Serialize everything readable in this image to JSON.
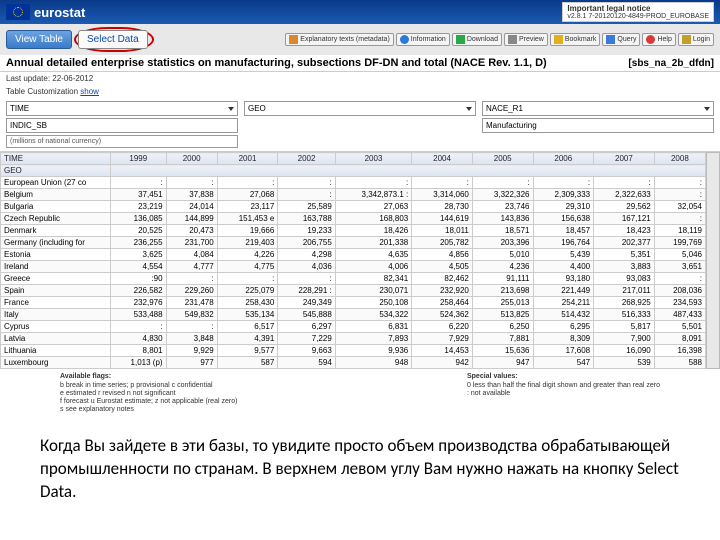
{
  "header": {
    "brand": "eurostat",
    "legal_title": "Important legal notice",
    "legal_sub": "v2.8.1 7-20120120-4849-PROD_EUROBASE"
  },
  "tabs": {
    "view": "View Table",
    "select": "Select Data"
  },
  "toolbar": {
    "exp": "Explanatory texts (metadata)",
    "info": "Information",
    "down": "Download",
    "prev": "Preview",
    "book": "Bookmark",
    "query": "Query",
    "help": "Help",
    "login": "Login"
  },
  "page": {
    "title": "Annual detailed enterprise statistics on manufacturing, subsections DF-DN and total (NACE Rev. 1.1, D)",
    "code": "[sbs_na_2b_dfdn]",
    "lastupdate_label": "Last update:",
    "lastupdate": "22-06-2012",
    "customize_label": "Table Customization",
    "customize_link": "show"
  },
  "filters": {
    "c1a": "TIME",
    "c1b": "INDIC_SB",
    "c1c": "(millions of national currency)",
    "c2a": "GEO",
    "c3a": "NACE_R1",
    "c3b": "Manufacturing"
  },
  "grid": {
    "row_header": "TIME",
    "sub_header": "GEO",
    "years": [
      "1999",
      "2000",
      "2001",
      "2002",
      "2003",
      "2004",
      "2005",
      "2006",
      "2007",
      "2008"
    ],
    "rows": [
      {
        "geo": "European Union (27 co",
        "cells": [
          ":",
          ":",
          ":",
          ":",
          ":",
          ":",
          ":",
          ":",
          ":",
          ":"
        ]
      },
      {
        "geo": "Belgium",
        "cells": [
          "37,451",
          "37,838",
          "27,068",
          ":",
          "3,342,873.1 :",
          "3,314,060",
          "3,322,326",
          "2,309,333",
          "2,322,633",
          ":"
        ]
      },
      {
        "geo": "Bulgaria",
        "cells": [
          "23,219",
          "24,014",
          "23,117",
          "25,589",
          "27,063",
          "28,730",
          "23,746",
          "29,310",
          "29,562",
          "32,054"
        ]
      },
      {
        "geo": "Czech Republic",
        "cells": [
          "136,085",
          "144,899",
          "151,453 e",
          "163,788",
          "168,803",
          "144,619",
          "143,836",
          "156,638",
          "167,121",
          ":"
        ]
      },
      {
        "geo": "Denmark",
        "cells": [
          "20,525",
          "20,473",
          "19,666",
          "19,233",
          "18,426",
          "18,011",
          "18,571",
          "18,457",
          "18,423",
          "18,119"
        ]
      },
      {
        "geo": "Germany (including for",
        "cells": [
          "236,255",
          "231,700",
          "219,403",
          "206,755",
          "201,338",
          "205,782",
          "203,396",
          "196,764",
          "202,377",
          "199,769"
        ]
      },
      {
        "geo": "Estonia",
        "cells": [
          "3,625",
          "4,084",
          "4,226",
          "4,298",
          "4,635",
          "4,856",
          "5,010",
          "5,439",
          "5,351",
          "5,046"
        ]
      },
      {
        "geo": "Ireland",
        "cells": [
          "4,554",
          "4,777",
          "4,775",
          "4,036",
          "4,006",
          "4,505",
          "4,236",
          "4,400",
          "3,883",
          "3,651"
        ]
      },
      {
        "geo": "Greece",
        "cells": [
          ":90",
          ":",
          ":",
          ":",
          "82,341",
          "82,462",
          "91,111",
          "93,180",
          "93,083",
          ":"
        ]
      },
      {
        "geo": "Spain",
        "cells": [
          "226,582",
          "229,260",
          "225,079",
          "228,291 :",
          "230,071",
          "232,920",
          "213,698",
          "221,449",
          "217,011",
          "208,036"
        ]
      },
      {
        "geo": "France",
        "cells": [
          "232,976",
          "231,478",
          "258,430",
          "249,349",
          "250,108",
          "258,464",
          "255,013",
          "254,211",
          "268,925",
          "234,593"
        ]
      },
      {
        "geo": "Italy",
        "cells": [
          "533,488",
          "549,832",
          "535,134",
          "545,888",
          "534,322",
          "524,362",
          "513,825",
          "514,432",
          "516,333",
          "487,433"
        ]
      },
      {
        "geo": "Cyprus",
        "cells": [
          ":",
          ":",
          "6,517",
          "6,297",
          "6,831",
          "6,220",
          "6,250",
          "6,295",
          "5,817",
          "5,501"
        ]
      },
      {
        "geo": "Latvia",
        "cells": [
          "4,830",
          "3,848",
          "4,391",
          "7,229",
          "7,893",
          "7,929",
          "7,881",
          "8,309",
          "7,900",
          "8,091"
        ]
      },
      {
        "geo": "Lithuania",
        "cells": [
          "8,801",
          "9,929",
          "9,577",
          "9,663",
          "9,936",
          "14,453",
          "15,636",
          "17,608",
          "16,090",
          "16,398"
        ]
      },
      {
        "geo": "Luxembourg",
        "cells": [
          "1,013 (p)",
          "977",
          "587",
          "594",
          "948",
          "942",
          "947",
          "547",
          "539",
          "588"
        ]
      }
    ]
  },
  "legend": {
    "left_hdr": "Available flags:",
    "l1": "b  break in time series; p  provisional      c  confidential",
    "l2": "e  estimated           r  revised            n  not significant",
    "l3": "f  forecast            u  Eurostat estimate; z  not applicable (real zero)",
    "l4": "s  see explanatory notes",
    "right_hdr": "Special values:",
    "r1": "0  less than half the final digit shown and greater than real zero",
    "r2": ":  not available"
  },
  "caption": "Когда Вы зайдете в эти базы, то увидите просто объем производства обрабатывающей промышленности по странам. В верхнем левом углу Вам нужно нажать на кнопку Select Data."
}
